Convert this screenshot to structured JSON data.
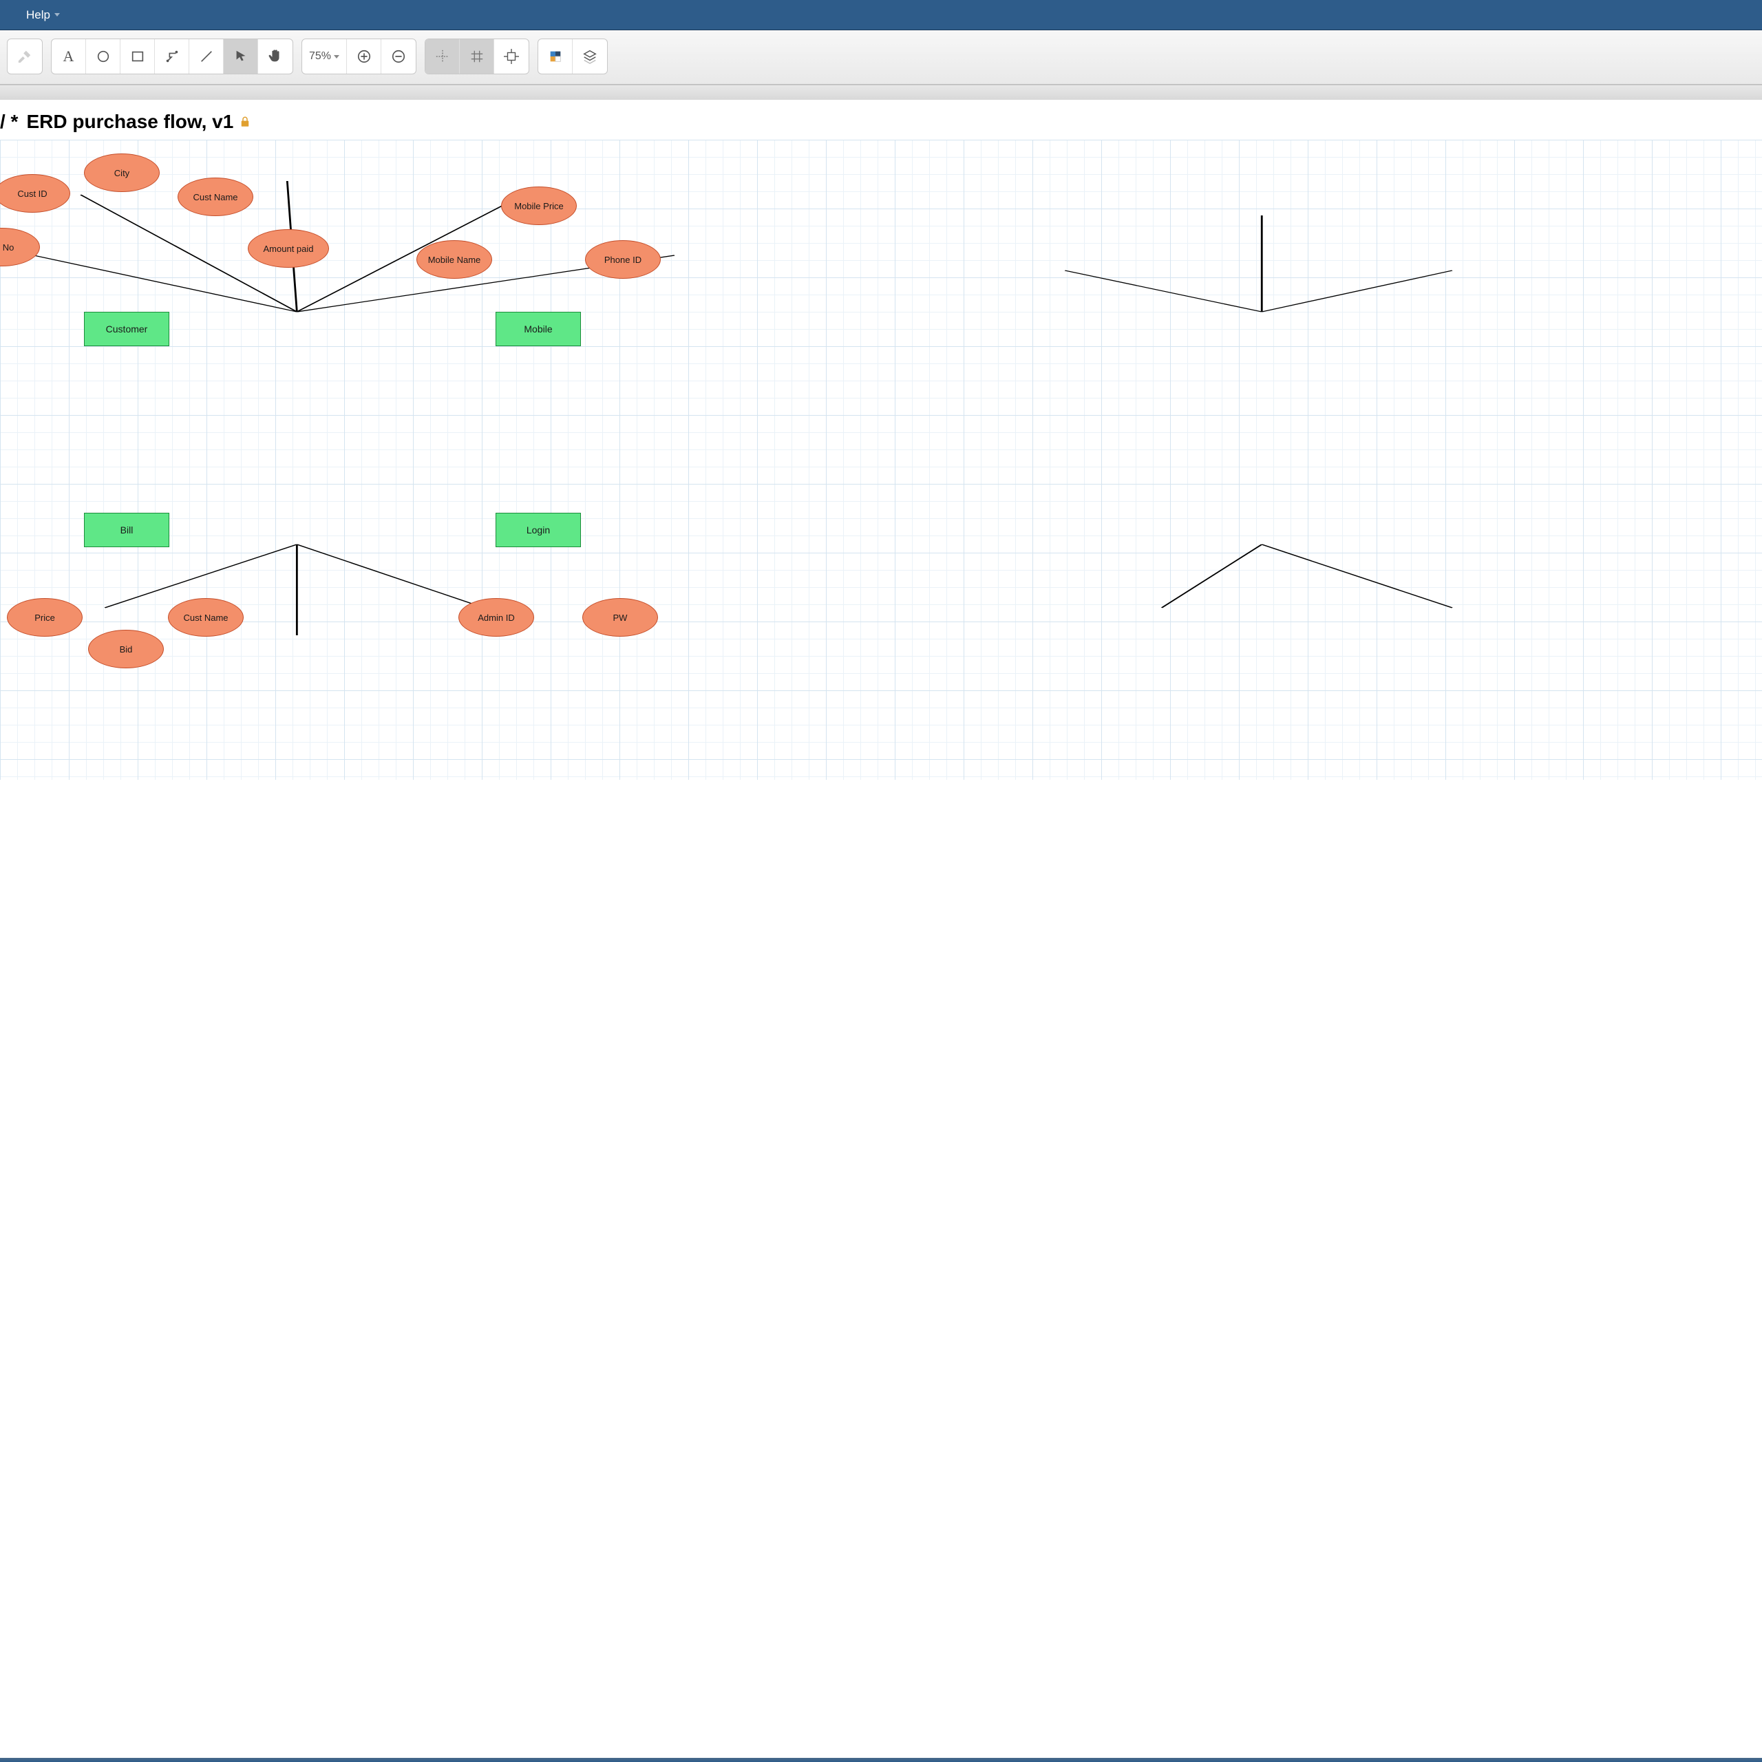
{
  "menubar": {
    "help": "Help"
  },
  "toolbar": {
    "zoom_label": "75%"
  },
  "doc": {
    "title_prefix": "/ *",
    "title": "ERD purchase flow, v1"
  },
  "diagram": {
    "entities": {
      "customer": "Customer",
      "mobile": "Mobile",
      "bill": "Bill",
      "login": "Login"
    },
    "attributes": {
      "cust_id": "Cust ID",
      "city": "City",
      "cust_name_1": "Cust Name",
      "phone_no": "ne No",
      "amount_paid": "Amount paid",
      "mobile_price": "Mobile Price",
      "mobile_name": "Mobile Name",
      "phone_id": "Phone ID",
      "price": "Price",
      "bid": "Bid",
      "cust_name_2": "Cust Name",
      "admin_id": "Admin ID",
      "pw": "PW"
    }
  },
  "colors": {
    "menubar": "#2e5c8a",
    "entity_fill": "#5fe787",
    "entity_stroke": "#1a8c3a",
    "attr_fill": "#f38f6a",
    "attr_stroke": "#c44d29"
  },
  "chart_data": {
    "type": "table",
    "title": "ERD purchase flow, v1",
    "entities": [
      {
        "name": "Customer",
        "attributes": [
          "Cust ID",
          "City",
          "Cust Name",
          "Phone No",
          "Amount paid"
        ]
      },
      {
        "name": "Mobile",
        "attributes": [
          "Mobile Price",
          "Mobile Name",
          "Phone ID"
        ]
      },
      {
        "name": "Bill",
        "attributes": [
          "Price",
          "Bid",
          "Cust Name"
        ]
      },
      {
        "name": "Login",
        "attributes": [
          "Admin ID",
          "PW"
        ]
      }
    ]
  }
}
